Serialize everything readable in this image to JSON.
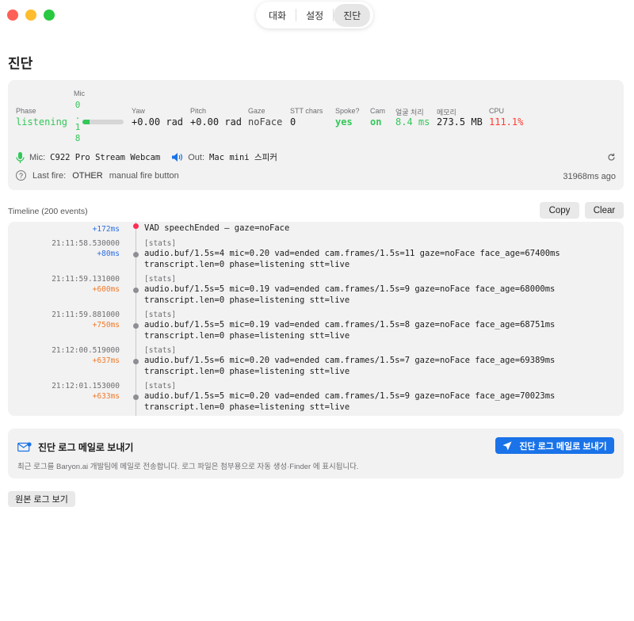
{
  "tabs": [
    {
      "label": "대화",
      "active": false
    },
    {
      "label": "설정",
      "active": false
    },
    {
      "label": "진단",
      "active": true
    }
  ],
  "title": "진단",
  "status": {
    "phase_label": "Phase",
    "phase_value": "listening",
    "mic_label": "Mic",
    "mic_digits": [
      "0",
      ".",
      "1",
      "8"
    ],
    "mic_level_fraction": 0.18,
    "yaw_label": "Yaw",
    "yaw_value": "+0.00 rad",
    "pitch_label": "Pitch",
    "pitch_value": "+0.00 rad",
    "gaze_label": "Gaze",
    "gaze_value": "noFace",
    "stt_label": "STT chars",
    "stt_value": "0",
    "spoke_label": "Spoke?",
    "spoke_value": "yes",
    "cam_label": "Cam",
    "cam_value": "on",
    "face_label": "얼굴 처리",
    "face_value": "8.4 ms",
    "mem_label": "메모리",
    "mem_value": "273.5 MB",
    "cpu_label": "CPU",
    "cpu_value": "111.1%",
    "mic_device_label": "Mic:",
    "mic_device": "C922 Pro Stream Webcam",
    "out_label": "Out:",
    "out_device": "Mac mini 스피커",
    "last_fire_label": "Last fire:",
    "last_fire_type": "OTHER",
    "last_fire_source": "manual fire button",
    "last_fire_ago": "31968ms ago",
    "colors": {
      "green": "#34c759",
      "red": "#ff3b30"
    }
  },
  "timeline": {
    "title": "Timeline (200 events)",
    "copy_label": "Copy",
    "clear_label": "Clear",
    "entries": [
      {
        "time": "",
        "delta": "+172ms",
        "delta_color": "blue",
        "dot": "red",
        "tag": "",
        "lines": "VAD speechEnded — gaze=noFace"
      },
      {
        "time": "21:11:58.530000",
        "delta": "+80ms",
        "delta_color": "blue",
        "dot": "gray",
        "tag": "[stats]",
        "lines": "audio.buf/1.5s=4 mic=0.20 vad=ended cam.frames/1.5s=11 gaze=noFace face_age=67400ms\ntranscript.len=0 phase=listening stt=live"
      },
      {
        "time": "21:11:59.131000",
        "delta": "+600ms",
        "delta_color": "orange",
        "dot": "gray",
        "tag": "[stats]",
        "lines": "audio.buf/1.5s=5 mic=0.19 vad=ended cam.frames/1.5s=9 gaze=noFace face_age=68000ms\ntranscript.len=0 phase=listening stt=live"
      },
      {
        "time": "21:11:59.881000",
        "delta": "+750ms",
        "delta_color": "orange",
        "dot": "gray",
        "tag": "[stats]",
        "lines": "audio.buf/1.5s=5 mic=0.19 vad=ended cam.frames/1.5s=8 gaze=noFace face_age=68751ms\ntranscript.len=0 phase=listening stt=live"
      },
      {
        "time": "21:12:00.519000",
        "delta": "+637ms",
        "delta_color": "orange",
        "dot": "gray",
        "tag": "[stats]",
        "lines": "audio.buf/1.5s=6 mic=0.20 vad=ended cam.frames/1.5s=7 gaze=noFace face_age=69389ms\ntranscript.len=0 phase=listening stt=live"
      },
      {
        "time": "21:12:01.153000",
        "delta": "+633ms",
        "delta_color": "orange",
        "dot": "gray",
        "tag": "[stats]",
        "lines": "audio.buf/1.5s=5 mic=0.20 vad=ended cam.frames/1.5s=9 gaze=noFace face_age=70023ms\ntranscript.len=0 phase=listening stt=live"
      }
    ]
  },
  "email": {
    "title": "진단 로그 메일로 보내기",
    "description": "최근 로그를 Baryon.ai 개발팀에 메일로 전송합니다. 로그 파일은 첨부용으로 자동 생성·Finder 에 표시됩니다.",
    "button_label": "진단 로그 메일로 보내기"
  },
  "raw_log_button": "원본 로그 보기",
  "icons": [
    "mic-icon",
    "speaker-icon",
    "refresh-icon",
    "question-icon",
    "mail-icon",
    "send-icon"
  ]
}
